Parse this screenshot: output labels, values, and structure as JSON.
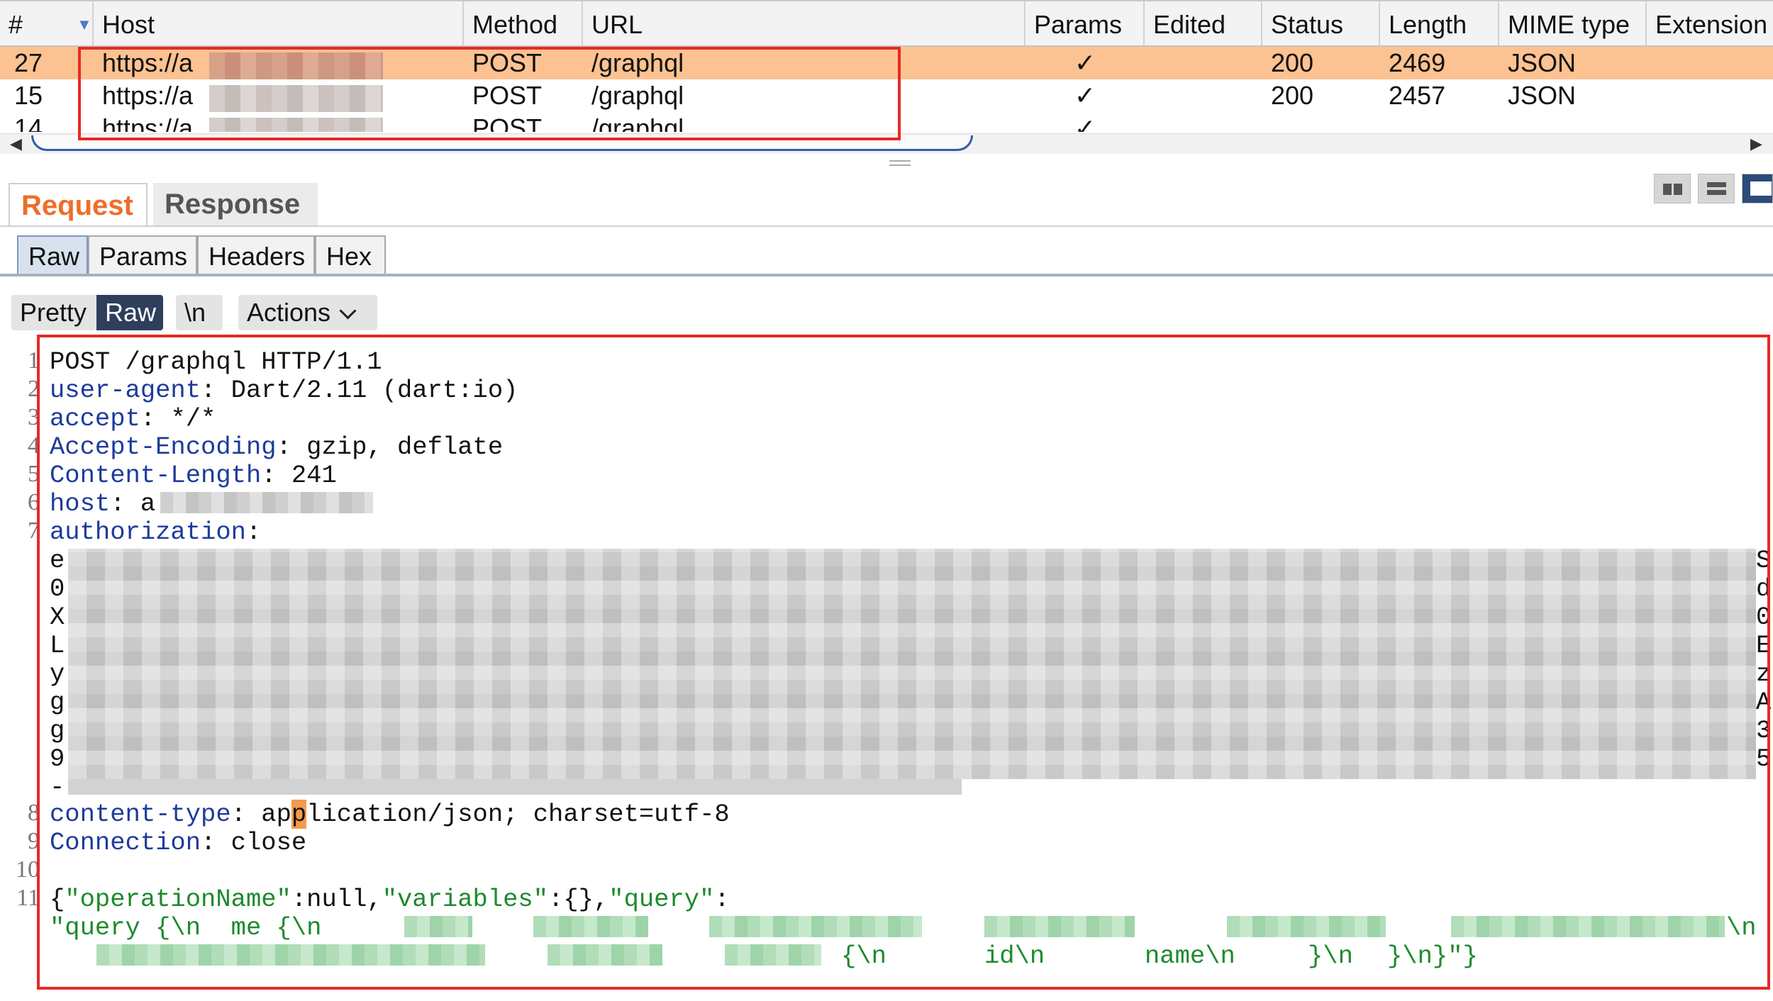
{
  "table": {
    "columns": [
      "#",
      "Host",
      "Method",
      "URL",
      "Params",
      "Edited",
      "Status",
      "Length",
      "MIME type",
      "Extension"
    ],
    "rows": [
      {
        "num": "27",
        "host": "https://a",
        "method": "POST",
        "url": "/graphql",
        "params": "✓",
        "status": "200",
        "length": "2469",
        "mime": "JSON",
        "selected": true
      },
      {
        "num": "15",
        "host": "https://a",
        "method": "POST",
        "url": "/graphql",
        "params": "✓",
        "status": "200",
        "length": "2457",
        "mime": "JSON",
        "selected": false
      },
      {
        "num": "14",
        "host": "https://a",
        "method": "POST",
        "url": "/graphql",
        "params": "✓",
        "status": "",
        "length": "",
        "mime": "",
        "selected": false
      }
    ]
  },
  "message_tabs": {
    "request": "Request",
    "response": "Response",
    "active": "Request"
  },
  "sub_tabs": {
    "raw": "Raw",
    "params": "Params",
    "headers": "Headers",
    "hex": "Hex",
    "active": "Raw"
  },
  "toolbar": {
    "pretty": "Pretty",
    "raw": "Raw",
    "newline": "\\n",
    "actions": "Actions"
  },
  "editor": {
    "line_numbers": [
      "1",
      "2",
      "3",
      "4",
      "5",
      "6",
      "7",
      "8",
      "9",
      "10",
      "11"
    ],
    "lines": {
      "l1": "POST /graphql HTTP/1.1",
      "l2_key": "user-agent",
      "l2_val": " Dart/2.11 (dart:io)",
      "l3_key": "accept",
      "l3_val": " */*",
      "l4_key": "Accept-Encoding",
      "l4_val": " gzip, deflate",
      "l5_key": "Content-Length",
      "l5_val": " 241",
      "l6_key": "host",
      "l6_val": " a",
      "l7_key": "authorization",
      "auth_left_chars": [
        "e",
        "0",
        "X",
        "L",
        "y",
        "g",
        "g",
        "9",
        "-"
      ],
      "auth_right_chars": [
        "S",
        "d",
        "0",
        "E",
        "z",
        "A",
        "3",
        "5",
        ""
      ],
      "l8_key": "content-type",
      "l8_val_a": " ap",
      "l8_val_caret": "p",
      "l8_val_b": "lication/json; charset=utf-8",
      "l9_key": "Connection",
      "l9_val": " close",
      "l11_a": "{",
      "l11_k1": "\"operationName\"",
      "l11_b": ":null,",
      "l11_k2": "\"variables\"",
      "l11_c": ":{},",
      "l11_k3": "\"query\"",
      "l11_d": ":",
      "l11_cont1": "\"query {\\n  me {\\n",
      "l11_cont1_end": "\\n",
      "l11_cont2_a": "{\\n",
      "l11_cont2_b": "id\\n",
      "l11_cont2_c": "name\\n",
      "l11_cont2_d": "}\\n",
      "l11_cont2_e": "}\\n}\"}"
    }
  },
  "colors": {
    "highlight_row": "#fcc291",
    "request_tab": "#ee6d2a",
    "header_key": "#1d3b9a",
    "json_string": "#1c8a2d",
    "annotation_box": "#e42a25"
  }
}
